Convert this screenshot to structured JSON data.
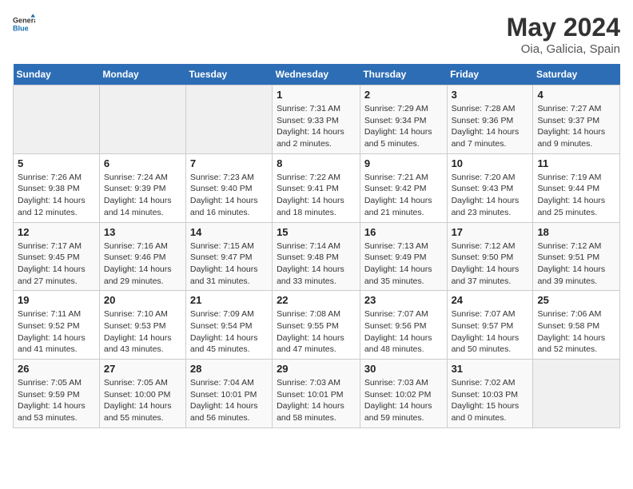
{
  "header": {
    "logo_general": "General",
    "logo_blue": "Blue",
    "title": "May 2024",
    "subtitle": "Oia, Galicia, Spain"
  },
  "days_of_week": [
    "Sunday",
    "Monday",
    "Tuesday",
    "Wednesday",
    "Thursday",
    "Friday",
    "Saturday"
  ],
  "weeks": [
    [
      {
        "day": "",
        "info": ""
      },
      {
        "day": "",
        "info": ""
      },
      {
        "day": "",
        "info": ""
      },
      {
        "day": "1",
        "info": "Sunrise: 7:31 AM\nSunset: 9:33 PM\nDaylight: 14 hours\nand 2 minutes."
      },
      {
        "day": "2",
        "info": "Sunrise: 7:29 AM\nSunset: 9:34 PM\nDaylight: 14 hours\nand 5 minutes."
      },
      {
        "day": "3",
        "info": "Sunrise: 7:28 AM\nSunset: 9:36 PM\nDaylight: 14 hours\nand 7 minutes."
      },
      {
        "day": "4",
        "info": "Sunrise: 7:27 AM\nSunset: 9:37 PM\nDaylight: 14 hours\nand 9 minutes."
      }
    ],
    [
      {
        "day": "5",
        "info": "Sunrise: 7:26 AM\nSunset: 9:38 PM\nDaylight: 14 hours\nand 12 minutes."
      },
      {
        "day": "6",
        "info": "Sunrise: 7:24 AM\nSunset: 9:39 PM\nDaylight: 14 hours\nand 14 minutes."
      },
      {
        "day": "7",
        "info": "Sunrise: 7:23 AM\nSunset: 9:40 PM\nDaylight: 14 hours\nand 16 minutes."
      },
      {
        "day": "8",
        "info": "Sunrise: 7:22 AM\nSunset: 9:41 PM\nDaylight: 14 hours\nand 18 minutes."
      },
      {
        "day": "9",
        "info": "Sunrise: 7:21 AM\nSunset: 9:42 PM\nDaylight: 14 hours\nand 21 minutes."
      },
      {
        "day": "10",
        "info": "Sunrise: 7:20 AM\nSunset: 9:43 PM\nDaylight: 14 hours\nand 23 minutes."
      },
      {
        "day": "11",
        "info": "Sunrise: 7:19 AM\nSunset: 9:44 PM\nDaylight: 14 hours\nand 25 minutes."
      }
    ],
    [
      {
        "day": "12",
        "info": "Sunrise: 7:17 AM\nSunset: 9:45 PM\nDaylight: 14 hours\nand 27 minutes."
      },
      {
        "day": "13",
        "info": "Sunrise: 7:16 AM\nSunset: 9:46 PM\nDaylight: 14 hours\nand 29 minutes."
      },
      {
        "day": "14",
        "info": "Sunrise: 7:15 AM\nSunset: 9:47 PM\nDaylight: 14 hours\nand 31 minutes."
      },
      {
        "day": "15",
        "info": "Sunrise: 7:14 AM\nSunset: 9:48 PM\nDaylight: 14 hours\nand 33 minutes."
      },
      {
        "day": "16",
        "info": "Sunrise: 7:13 AM\nSunset: 9:49 PM\nDaylight: 14 hours\nand 35 minutes."
      },
      {
        "day": "17",
        "info": "Sunrise: 7:12 AM\nSunset: 9:50 PM\nDaylight: 14 hours\nand 37 minutes."
      },
      {
        "day": "18",
        "info": "Sunrise: 7:12 AM\nSunset: 9:51 PM\nDaylight: 14 hours\nand 39 minutes."
      }
    ],
    [
      {
        "day": "19",
        "info": "Sunrise: 7:11 AM\nSunset: 9:52 PM\nDaylight: 14 hours\nand 41 minutes."
      },
      {
        "day": "20",
        "info": "Sunrise: 7:10 AM\nSunset: 9:53 PM\nDaylight: 14 hours\nand 43 minutes."
      },
      {
        "day": "21",
        "info": "Sunrise: 7:09 AM\nSunset: 9:54 PM\nDaylight: 14 hours\nand 45 minutes."
      },
      {
        "day": "22",
        "info": "Sunrise: 7:08 AM\nSunset: 9:55 PM\nDaylight: 14 hours\nand 47 minutes."
      },
      {
        "day": "23",
        "info": "Sunrise: 7:07 AM\nSunset: 9:56 PM\nDaylight: 14 hours\nand 48 minutes."
      },
      {
        "day": "24",
        "info": "Sunrise: 7:07 AM\nSunset: 9:57 PM\nDaylight: 14 hours\nand 50 minutes."
      },
      {
        "day": "25",
        "info": "Sunrise: 7:06 AM\nSunset: 9:58 PM\nDaylight: 14 hours\nand 52 minutes."
      }
    ],
    [
      {
        "day": "26",
        "info": "Sunrise: 7:05 AM\nSunset: 9:59 PM\nDaylight: 14 hours\nand 53 minutes."
      },
      {
        "day": "27",
        "info": "Sunrise: 7:05 AM\nSunset: 10:00 PM\nDaylight: 14 hours\nand 55 minutes."
      },
      {
        "day": "28",
        "info": "Sunrise: 7:04 AM\nSunset: 10:01 PM\nDaylight: 14 hours\nand 56 minutes."
      },
      {
        "day": "29",
        "info": "Sunrise: 7:03 AM\nSunset: 10:01 PM\nDaylight: 14 hours\nand 58 minutes."
      },
      {
        "day": "30",
        "info": "Sunrise: 7:03 AM\nSunset: 10:02 PM\nDaylight: 14 hours\nand 59 minutes."
      },
      {
        "day": "31",
        "info": "Sunrise: 7:02 AM\nSunset: 10:03 PM\nDaylight: 15 hours\nand 0 minutes."
      },
      {
        "day": "",
        "info": ""
      }
    ]
  ]
}
